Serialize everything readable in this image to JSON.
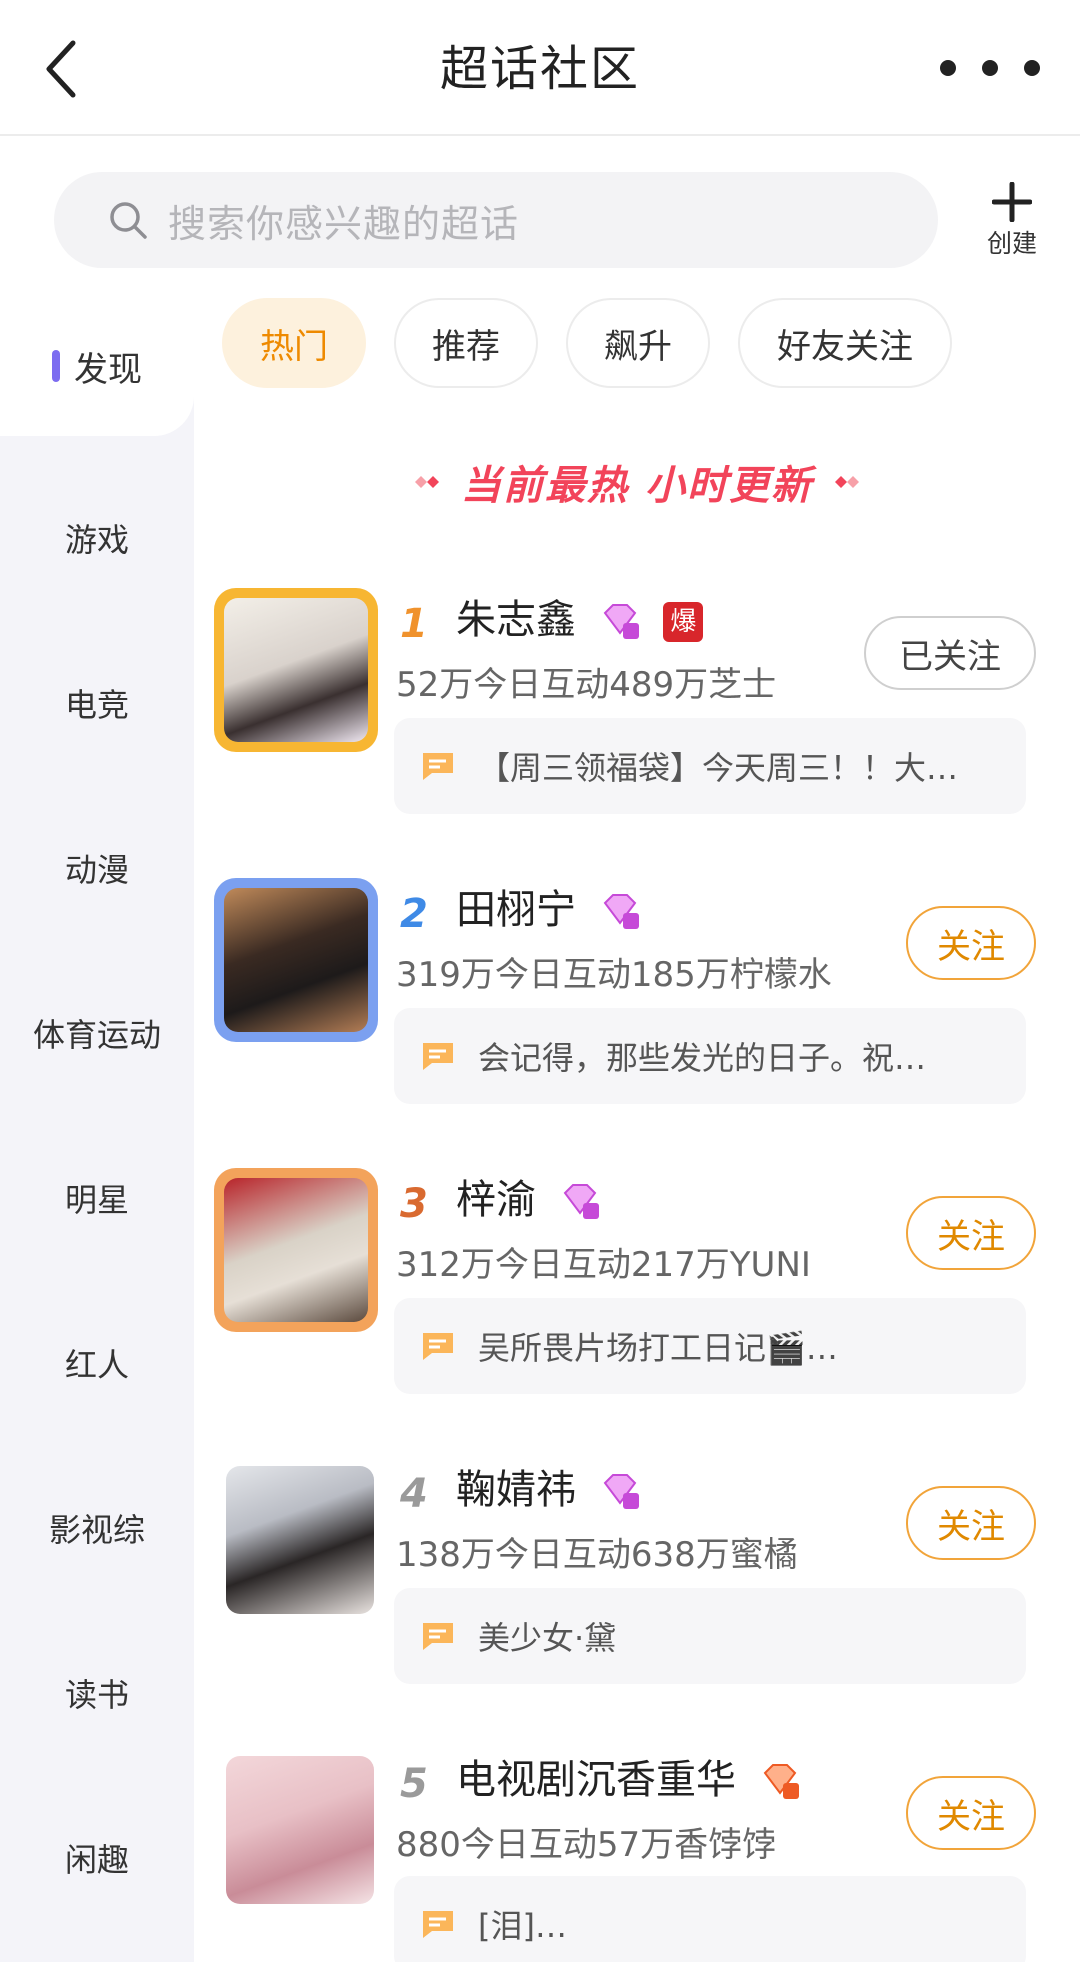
{
  "header": {
    "title": "超话社区"
  },
  "search": {
    "placeholder": "搜索你感兴趣的超话",
    "create_label": "创建"
  },
  "sidebar": {
    "items": [
      {
        "label": "发现",
        "active": true
      },
      {
        "label": "游戏"
      },
      {
        "label": "电竞"
      },
      {
        "label": "动漫"
      },
      {
        "label": "体育运动"
      },
      {
        "label": "明星"
      },
      {
        "label": "红人"
      },
      {
        "label": "影视综"
      },
      {
        "label": "读书"
      },
      {
        "label": "闲趣"
      }
    ]
  },
  "tabs": [
    {
      "label": "热门",
      "active": true
    },
    {
      "label": "推荐"
    },
    {
      "label": "飙升"
    },
    {
      "label": "好友关注"
    }
  ],
  "banner": {
    "text": "当前最热 小时更新"
  },
  "colors": {
    "accent": "#ee8a00",
    "banner": "#f2445a",
    "sidebar_mark": "#7c6cf0"
  },
  "ranking": [
    {
      "rank": "1",
      "name": "朱志鑫",
      "badge": "diamond-level-icon",
      "hot_tag": "爆",
      "stats": "52万今日互动489万芝士",
      "follow": "已关注",
      "post": "【周三领福袋】今天周三！！大…"
    },
    {
      "rank": "2",
      "name": "田栩宁",
      "badge": "diamond-level-icon",
      "stats": "319万今日互动185万柠檬水",
      "follow": "关注",
      "post": "会记得，那些发光的日子。祝…"
    },
    {
      "rank": "3",
      "name": "梓渝",
      "badge": "diamond-level-icon",
      "stats": "312万今日互动217万YUNI",
      "follow": "关注",
      "post": "吴所畏片场打工日记🎬…"
    },
    {
      "rank": "4",
      "name": "鞠婧祎",
      "badge": "diamond-level-icon",
      "stats": "138万今日互动638万蜜橘",
      "follow": "关注",
      "post": "美少女·黛"
    },
    {
      "rank": "5",
      "name": "电视剧沉香重华",
      "badge": "diamond-level-icon",
      "stats": "880今日互动57万香饽饽",
      "follow": "关注",
      "post": "[泪]…"
    }
  ]
}
